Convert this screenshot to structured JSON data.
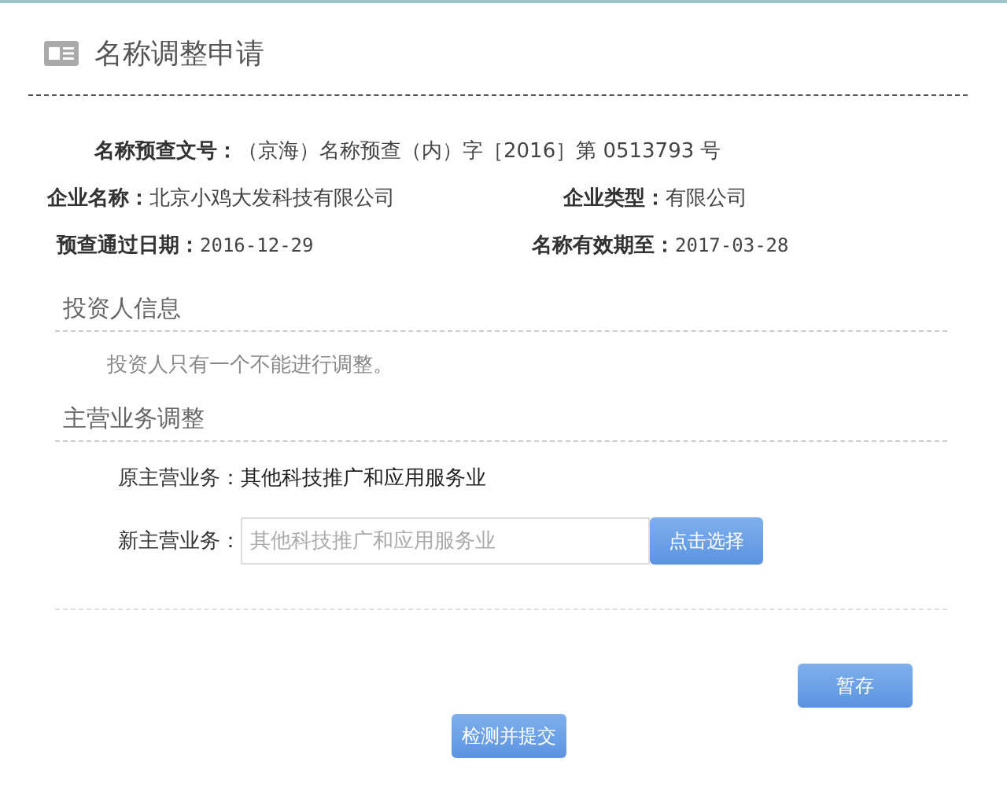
{
  "header": {
    "title": "名称调整申请"
  },
  "info": {
    "document_no": {
      "label": "名称预查文号：",
      "value": "（京海）名称预查（内）字［2016］第 0513793 号"
    },
    "rows": [
      [
        {
          "label": "企业名称：",
          "value": "北京小鸡大发科技有限公司"
        },
        {
          "label": "企业类型：",
          "value": "有限公司"
        }
      ],
      [
        {
          "label": "预查通过日期：",
          "value": "2016-12-29"
        },
        {
          "label": "名称有效期至：",
          "value": "2017-03-28"
        }
      ]
    ]
  },
  "investor_section": {
    "title": "投资人信息",
    "note": "投资人只有一个不能进行调整。"
  },
  "business_section": {
    "title": "主营业务调整",
    "original": {
      "label": "原主营业务：",
      "value": "其他科技推广和应用服务业"
    },
    "new": {
      "label": "新主营业务：",
      "placeholder": "其他科技推广和应用服务业",
      "button": "点击选择"
    }
  },
  "buttons": {
    "save": "暂存",
    "submit": "检测并提交"
  }
}
